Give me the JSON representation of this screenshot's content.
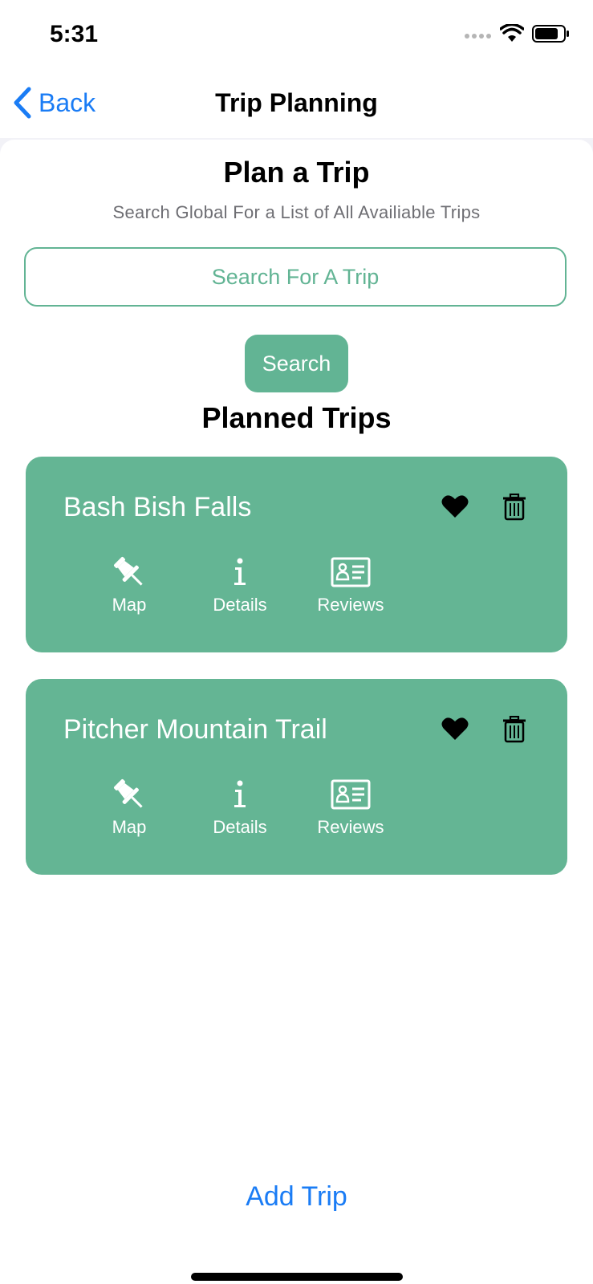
{
  "status_bar": {
    "time": "5:31"
  },
  "nav": {
    "back_label": "Back",
    "title": "Trip Planning"
  },
  "plan": {
    "title": "Plan a Trip",
    "subtitle": "Search Global For a List of All Availiable Trips",
    "search_placeholder": "Search For A Trip",
    "search_button": "Search"
  },
  "planned": {
    "title": "Planned Trips",
    "trips": [
      {
        "name": "Bash Bish Falls",
        "actions": {
          "map": "Map",
          "details": "Details",
          "reviews": "Reviews"
        }
      },
      {
        "name": "Pitcher Mountain Trail",
        "actions": {
          "map": "Map",
          "details": "Details",
          "reviews": "Reviews"
        }
      }
    ]
  },
  "footer": {
    "add_trip": "Add Trip"
  },
  "colors": {
    "accent_green": "#62b494",
    "link_blue": "#1a7cf5"
  }
}
